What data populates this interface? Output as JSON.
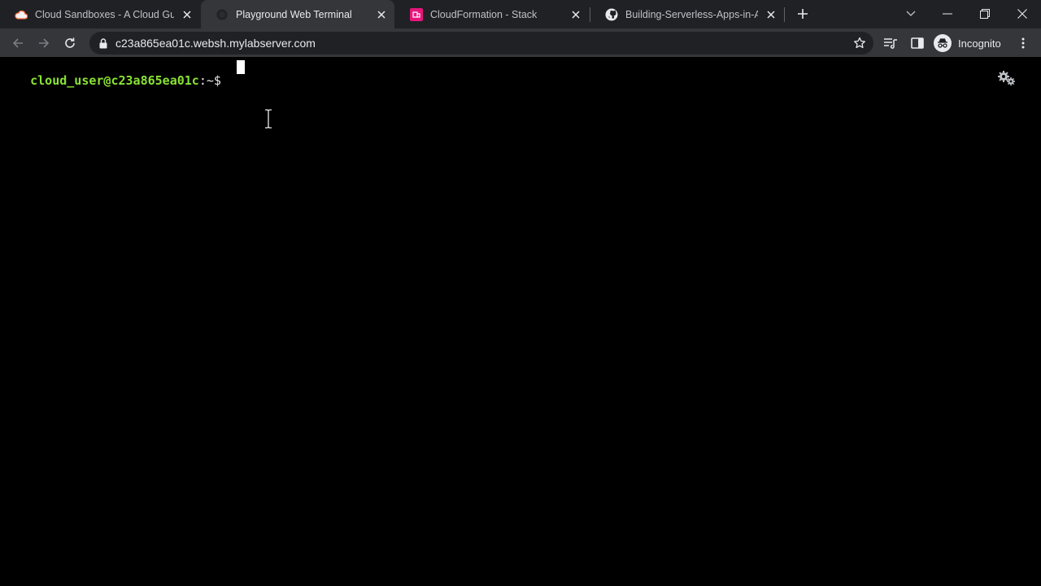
{
  "tabs": [
    {
      "title": "Cloud Sandboxes - A Cloud Guru",
      "favicon": "cloud-icon",
      "active": false
    },
    {
      "title": "Playground Web Terminal",
      "favicon": "terminal-favicon-icon",
      "active": true
    },
    {
      "title": "CloudFormation - Stack",
      "favicon": "cloudformation-icon",
      "active": false
    },
    {
      "title": "Building-Serverless-Apps-in-AWS",
      "favicon": "github-icon",
      "active": false
    }
  ],
  "toolbar": {
    "url": "c23a865ea01c.websh.mylabserver.com",
    "profile_label": "Incognito"
  },
  "terminal": {
    "prompt_user_host": "cloud_user@c23a865ea01c",
    "prompt_path": ":~$ "
  },
  "colors": {
    "tabstrip": "#202124",
    "toolbar": "#35363a",
    "omnibox": "#202124",
    "terminal_bg": "#000000",
    "prompt_green": "#8ae234",
    "cloudformation_pink": "#e7157b"
  }
}
